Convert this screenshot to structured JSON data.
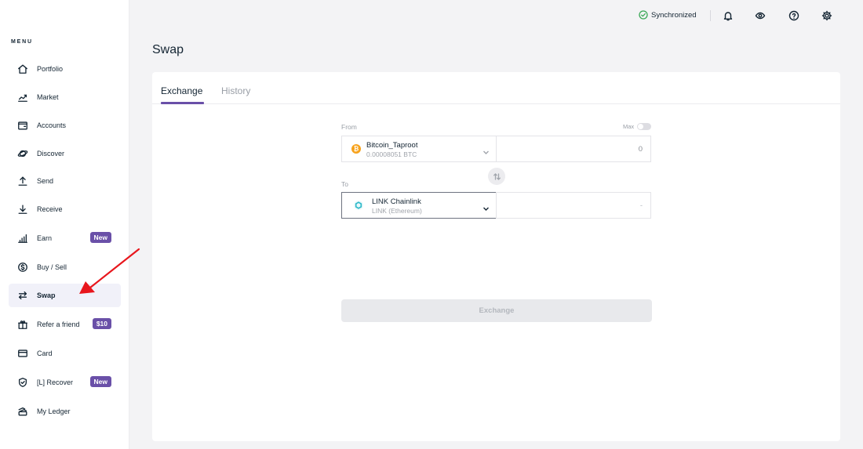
{
  "sidebar": {
    "menu_label": "MENU",
    "items": [
      {
        "label": "Portfolio",
        "icon": "home-icon"
      },
      {
        "label": "Market",
        "icon": "market-chart-icon"
      },
      {
        "label": "Accounts",
        "icon": "wallet-icon"
      },
      {
        "label": "Discover",
        "icon": "planet-icon"
      },
      {
        "label": "Send",
        "icon": "arrow-up-icon"
      },
      {
        "label": "Receive",
        "icon": "arrow-down-icon"
      },
      {
        "label": "Earn",
        "icon": "earn-chart-icon",
        "badge": "New"
      },
      {
        "label": "Buy / Sell",
        "icon": "dollar-icon"
      },
      {
        "label": "Swap",
        "icon": "swap-icon",
        "active": true
      },
      {
        "label": "Refer a friend",
        "icon": "gift-icon",
        "badge": "$10"
      },
      {
        "label": "Card",
        "icon": "card-icon"
      },
      {
        "label": "[L] Recover",
        "icon": "shield-icon",
        "badge": "New"
      },
      {
        "label": "My Ledger",
        "icon": "ledger-icon"
      }
    ]
  },
  "topbar": {
    "sync_status": "Synchronized"
  },
  "page": {
    "title": "Swap"
  },
  "tabs": [
    {
      "label": "Exchange",
      "active": true
    },
    {
      "label": "History",
      "active": false
    }
  ],
  "swap_form": {
    "from_label": "From",
    "max_label": "Max",
    "from_asset": {
      "name": "Bitcoin_Taproot",
      "balance": "0.00008051 BTC"
    },
    "from_amount": "0",
    "to_label": "To",
    "to_asset": {
      "name": "LINK Chainlink",
      "network": "LINK (Ethereum)"
    },
    "to_amount": "-",
    "exchange_button": "Exchange"
  },
  "colors": {
    "accent": "#6a50a8",
    "sync_green": "#3aa856",
    "bitcoin_orange": "#f7a21b",
    "chainlink_teal": "#2ab8c8",
    "annotation_red": "#e8161c"
  }
}
